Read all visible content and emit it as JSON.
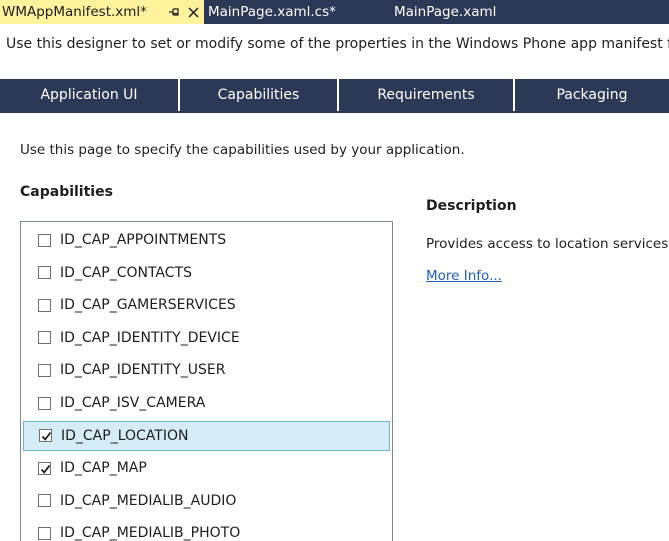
{
  "doc_tabs": [
    {
      "label": "WMAppManifest.xml*",
      "active": true
    },
    {
      "label": "MainPage.xaml.cs*",
      "active": false
    },
    {
      "label": "MainPage.xaml",
      "active": false
    }
  ],
  "intro": "Use this designer to set or modify some of the properties in the Windows Phone app manifest file.",
  "designer_tabs": [
    {
      "label": "Application UI",
      "active": false
    },
    {
      "label": "Capabilities",
      "active": true
    },
    {
      "label": "Requirements",
      "active": false
    },
    {
      "label": "Packaging",
      "active": false
    }
  ],
  "page_description": "Use this page to specify the capabilities used by your application.",
  "capabilities": {
    "title": "Capabilities",
    "items": [
      {
        "label": "ID_CAP_APPOINTMENTS",
        "checked": false,
        "selected": false
      },
      {
        "label": "ID_CAP_CONTACTS",
        "checked": false,
        "selected": false
      },
      {
        "label": "ID_CAP_GAMERSERVICES",
        "checked": false,
        "selected": false
      },
      {
        "label": "ID_CAP_IDENTITY_DEVICE",
        "checked": false,
        "selected": false
      },
      {
        "label": "ID_CAP_IDENTITY_USER",
        "checked": false,
        "selected": false
      },
      {
        "label": "ID_CAP_ISV_CAMERA",
        "checked": false,
        "selected": false
      },
      {
        "label": "ID_CAP_LOCATION",
        "checked": true,
        "selected": true
      },
      {
        "label": "ID_CAP_MAP",
        "checked": true,
        "selected": false
      },
      {
        "label": "ID_CAP_MEDIALIB_AUDIO",
        "checked": false,
        "selected": false
      },
      {
        "label": "ID_CAP_MEDIALIB_PHOTO",
        "checked": false,
        "selected": false
      }
    ]
  },
  "description": {
    "title": "Description",
    "text": "Provides access to location services.",
    "link": "More Info..."
  },
  "colors": {
    "tab_bar": "#2b3856",
    "active_doc_tab": "#fff29d",
    "selection_bg": "#d5ebf5",
    "link": "#1e5fbf"
  }
}
